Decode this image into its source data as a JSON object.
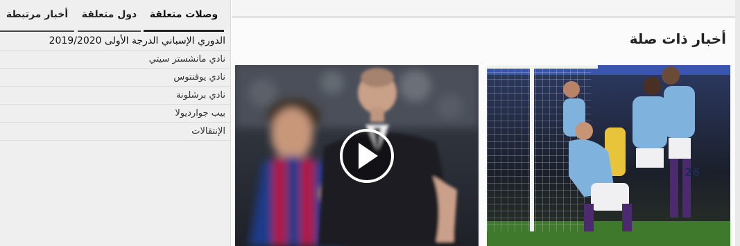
{
  "sidebar": {
    "tabs": [
      {
        "label": "وصلات متعلقة",
        "active": true
      },
      {
        "label": "دول متعلقة",
        "active": false
      },
      {
        "label": "أخبار مرتبطة",
        "active": false
      }
    ],
    "links": [
      "الدوري الإسباني الدرجة الأولى 2019/2020",
      "نادي مانشستر سيتي",
      "نادي يوفنتوس",
      "نادي برشلونة",
      "بيب جوارديولا",
      "الإنتقالات"
    ]
  },
  "main": {
    "section_title": "أخبار ذات صلة",
    "cards": [
      {
        "kind": "video",
        "icon": "play-icon"
      },
      {
        "kind": "photo",
        "icon": null
      }
    ]
  },
  "colors": {
    "sidebar_bg": "#efefef",
    "barca_blue": "#1d3a8a",
    "barca_red": "#b5123a",
    "city_blue": "#7fb3de",
    "pitch_green": "#3f7a2c",
    "crowd_dark": "#1b1f2a"
  }
}
